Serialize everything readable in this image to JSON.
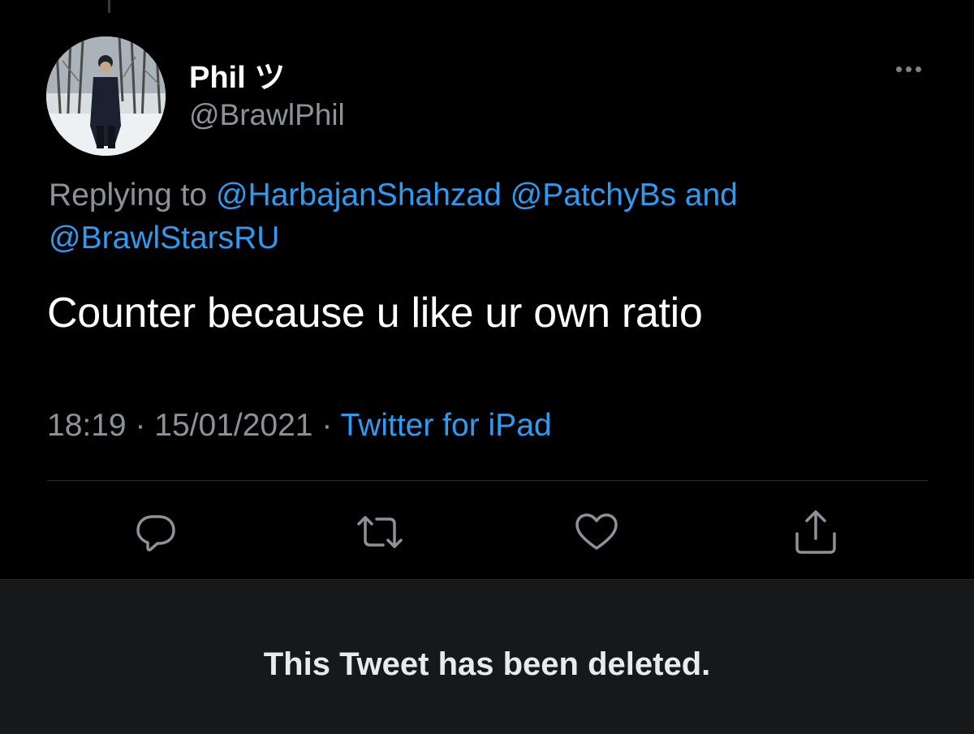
{
  "tweet": {
    "display_name": "Phil ツ",
    "handle": "@BrawlPhil",
    "reply_context": {
      "prefix": "Replying to ",
      "mention_1": "@HarbajanShahzad",
      "mention_2": "@PatchyBs",
      "conjunction": " and",
      "mention_3": "@BrawlStarsRU"
    },
    "text": "Counter because u like ur own ratio",
    "time": "18:19",
    "date": "15/01/2021",
    "separator": "·",
    "source": "Twitter for iPad"
  },
  "actions": {
    "reply_icon": "speech-bubble-icon",
    "retweet_icon": "retweet-arrows-icon",
    "like_icon": "heart-icon",
    "share_icon": "share-upload-icon",
    "more_icon": "ellipsis-icon"
  },
  "deleted_notice": {
    "text": "This Tweet has been deleted."
  },
  "colors": {
    "background": "#000000",
    "link": "#2e9bf0",
    "secondary_text": "#8b9399",
    "icon": "#8b9399",
    "deleted_panel": "#16181a"
  }
}
